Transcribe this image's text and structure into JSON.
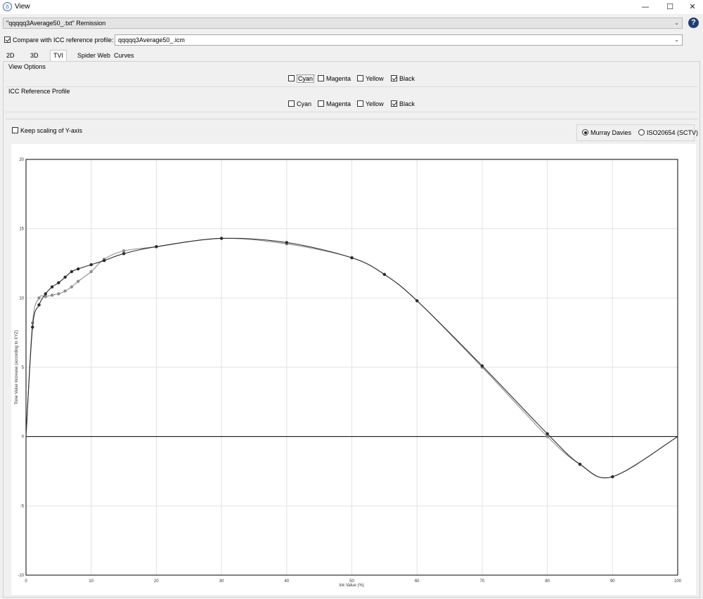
{
  "window": {
    "title": "View",
    "icon": "app-swirl-icon",
    "controls": {
      "minimize": "—",
      "maximize": "☐",
      "close": "✕"
    }
  },
  "toolbar": {
    "measurement_selected": "\"qqqqq3Average50_.txt\" Remission",
    "compare_label": "Compare with ICC reference profile:",
    "compare_checked": true,
    "profile_selected": "qqqqq3Average50_.icm",
    "help_label": "?"
  },
  "tabs": [
    {
      "label": "2D",
      "active": false
    },
    {
      "label": "3D",
      "active": false
    },
    {
      "label": "TVI",
      "active": true
    },
    {
      "label": "Spider Web",
      "active": false
    },
    {
      "label": "Curves",
      "active": false
    }
  ],
  "view_options": {
    "title": "View Options",
    "channels": [
      {
        "label": "Cyan",
        "checked": false
      },
      {
        "label": "Magenta",
        "checked": false
      },
      {
        "label": "Yellow",
        "checked": false
      },
      {
        "label": "Black",
        "checked": true
      }
    ]
  },
  "icc_profile": {
    "title": "ICC Reference Profile",
    "channels": [
      {
        "label": "Cyan",
        "checked": false
      },
      {
        "label": "Magenta",
        "checked": false
      },
      {
        "label": "Yellow",
        "checked": false
      },
      {
        "label": "Black",
        "checked": true
      }
    ]
  },
  "keep_scaling": {
    "label": "Keep scaling of Y-axis",
    "checked": false
  },
  "formula": {
    "options": [
      {
        "label": "Murray Davies",
        "checked": true
      },
      {
        "label": "ISO20654 (SCTV)",
        "checked": false
      }
    ]
  },
  "chart_data": {
    "type": "line",
    "xlabel": "Ink Value (%)",
    "ylabel": "Tone Value Increase (according to XYZ)",
    "xlim": [
      0,
      100
    ],
    "ylim": [
      -10,
      20
    ],
    "xticks": [
      0,
      10,
      20,
      30,
      40,
      50,
      60,
      70,
      80,
      90,
      100
    ],
    "yticks": [
      -10,
      -5,
      0,
      5,
      10,
      15,
      20
    ],
    "grid": true,
    "colors": {
      "measured": "#2b2b2b",
      "reference": "#8e8e8e",
      "grid": "#e2e2e2"
    },
    "series": [
      {
        "role": "measured",
        "x": [
          0,
          1,
          2,
          3,
          4,
          5,
          6,
          7,
          8,
          10,
          12,
          15,
          20,
          30,
          40,
          50,
          55,
          60,
          70,
          80,
          85,
          90,
          100
        ],
        "y": [
          0,
          7.9,
          9.5,
          10.3,
          10.8,
          11.1,
          11.5,
          11.9,
          12.1,
          12.4,
          12.7,
          13.2,
          13.7,
          14.3,
          14.0,
          12.9,
          11.7,
          9.8,
          5.1,
          0.2,
          -2.0,
          -2.9,
          0
        ],
        "markers": [
          1,
          2,
          3,
          4,
          5,
          6,
          7,
          8,
          10,
          12,
          15,
          20,
          30,
          40,
          50,
          55,
          60,
          70,
          80,
          85,
          90
        ]
      },
      {
        "role": "reference",
        "x": [
          0,
          1,
          2,
          3,
          4,
          5,
          6,
          7,
          8,
          10,
          12,
          15,
          20,
          30,
          40,
          50,
          55,
          60,
          70,
          80,
          85,
          90,
          100
        ],
        "y": [
          0,
          8.2,
          10.0,
          10.1,
          10.2,
          10.3,
          10.5,
          10.8,
          11.2,
          11.9,
          12.8,
          13.4,
          13.7,
          14.3,
          13.9,
          12.9,
          11.7,
          9.8,
          5.0,
          0.0,
          -2.0,
          -2.9,
          0
        ],
        "markers": [
          1,
          2,
          3,
          4,
          5,
          6,
          7,
          8,
          10,
          12,
          15,
          20,
          30,
          40,
          50,
          55,
          60,
          70,
          80,
          85,
          90
        ]
      }
    ]
  }
}
